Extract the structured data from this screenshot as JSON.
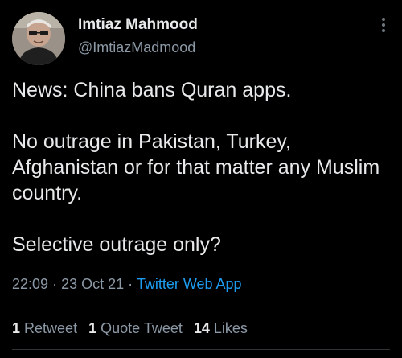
{
  "author": {
    "display_name": "Imtiaz Mahmood",
    "handle": "@ImtiazMadmood",
    "avatar_icon": "profile-photo"
  },
  "tweet": {
    "lines": [
      "News: China bans Quran apps.",
      "",
      "No outrage in Pakistan, Turkey, Afghanistan or for that matter any Muslim country.",
      "",
      "Selective outrage only?"
    ],
    "para1": "News: China bans Quran apps.",
    "para2": "No outrage in Pakistan, Turkey, Afghanistan or for that matter any Muslim country.",
    "para3": "Selective outrage only?"
  },
  "meta": {
    "time": "22:09",
    "separator": "·",
    "date": "23 Oct 21",
    "source": "Twitter Web App"
  },
  "stats": {
    "retweets_count": "1",
    "retweets_label": "Retweet",
    "quotes_count": "1",
    "quotes_label": "Quote Tweet",
    "likes_count": "14",
    "likes_label": "Likes"
  },
  "colors": {
    "background": "#000000",
    "text": "#e7e9ea",
    "secondary": "#8b98a5",
    "link": "#1d9bf0",
    "divider": "#2f3336"
  }
}
